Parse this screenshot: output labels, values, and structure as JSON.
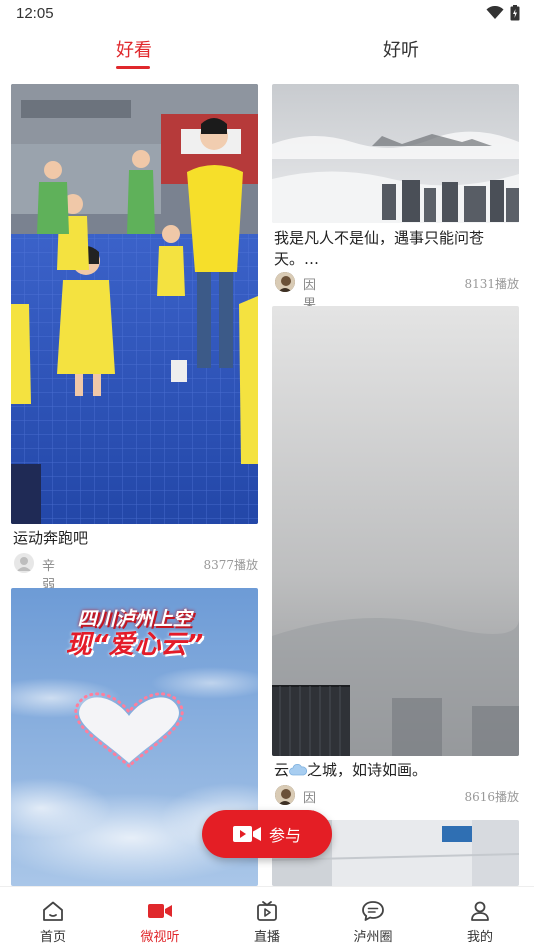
{
  "status_bar": {
    "time": "12:05",
    "wifi_icon": "wifi-icon",
    "battery_icon": "battery-icon"
  },
  "top_tabs": [
    {
      "label": "好看",
      "active": true
    },
    {
      "label": "好听",
      "active": false
    }
  ],
  "feed": {
    "left": [
      {
        "title": "运动奔跑吧",
        "author": "辛弱传",
        "plays": "8377播放",
        "avatar_icon": "default-avatar-icon"
      },
      {
        "overlay_line1": "四川泸州上空",
        "overlay_line2": "现“爱心云”"
      }
    ],
    "right": [
      {
        "title": "我是凡人不是仙，遇事只能问苍天。…",
        "author": "因果",
        "plays": "8131播放"
      },
      {
        "title_before": "云",
        "title_emoji": "cloud-emoji",
        "title_after": "之城，如诗如画。",
        "author": "因果",
        "plays": "8616播放"
      }
    ]
  },
  "join_button": {
    "label": "参与",
    "icon": "video-camera-icon"
  },
  "bottom_nav": [
    {
      "label": "首页",
      "icon": "home-icon",
      "active": false
    },
    {
      "label": "微视听",
      "icon": "video-icon",
      "active": true
    },
    {
      "label": "直播",
      "icon": "tv-play-icon",
      "active": false
    },
    {
      "label": "泸州圈",
      "icon": "chat-bubble-icon",
      "active": false
    },
    {
      "label": "我的",
      "icon": "profile-icon",
      "active": false
    }
  ],
  "colors": {
    "accent": "#e0282c",
    "join_button": "#e41e25",
    "text": "#222222",
    "muted": "#999999"
  }
}
